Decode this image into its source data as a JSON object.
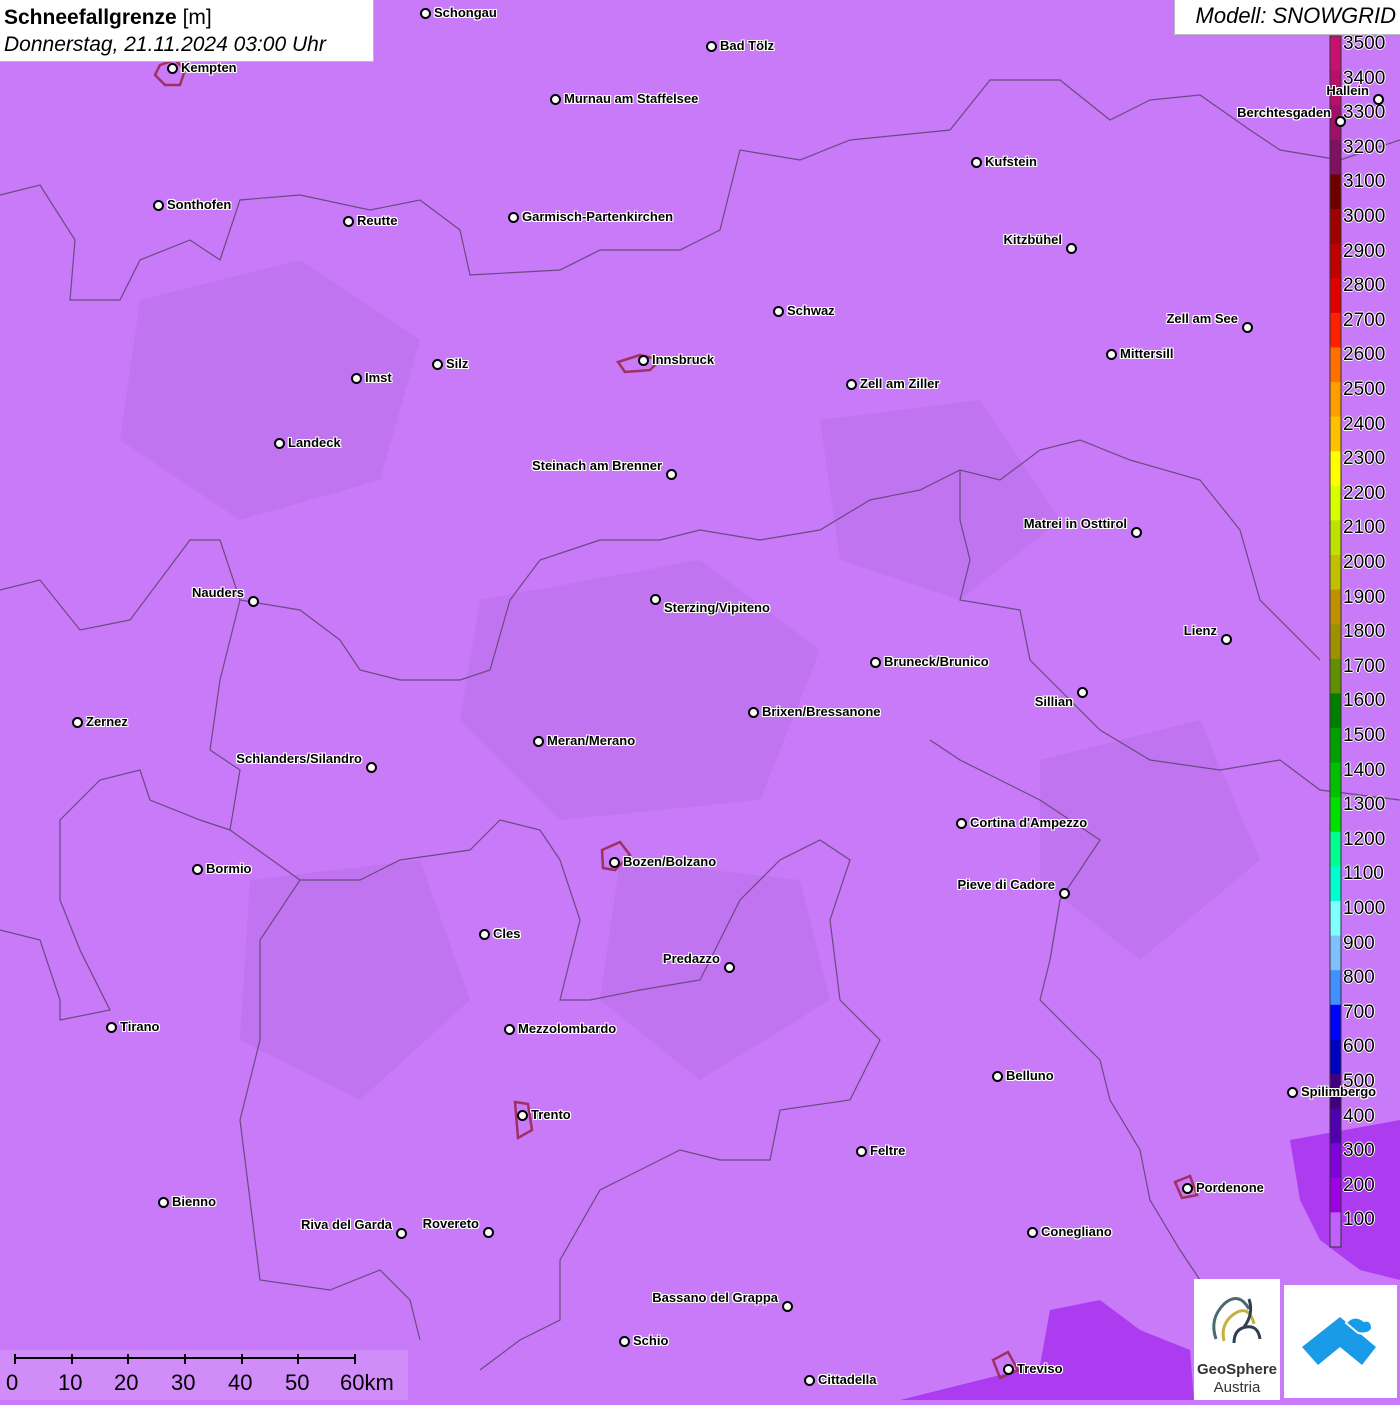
{
  "header": {
    "title_bold": "Schneefallgrenze",
    "title_unit": "[m]",
    "datetime": "Donnerstag, 21.11.2024 03:00 Uhr",
    "model": "Modell: SNOWGRID"
  },
  "legend": {
    "labels": [
      "3500",
      "3400",
      "3300",
      "3200",
      "3100",
      "3000",
      "2900",
      "2800",
      "2700",
      "2600",
      "2500",
      "2400",
      "2300",
      "2200",
      "2100",
      "2000",
      "1900",
      "1800",
      "1700",
      "1600",
      "1500",
      "1400",
      "1300",
      "1200",
      "1100",
      "1000",
      "900",
      "800",
      "700",
      "600",
      "500",
      "400",
      "300",
      "200",
      "100"
    ],
    "colors": [
      "#c8106e",
      "#b8106a",
      "#a01068",
      "#801060",
      "#700000",
      "#a00000",
      "#c00000",
      "#e00000",
      "#ff2000",
      "#ff7000",
      "#ff9c00",
      "#ffc000",
      "#ffff00",
      "#d8ff00",
      "#c0e000",
      "#c0c000",
      "#c09000",
      "#a09000",
      "#609000",
      "#008000",
      "#00a000",
      "#00c000",
      "#00e000",
      "#00ff90",
      "#00ffd0",
      "#80ffff",
      "#80c0ff",
      "#4090ff",
      "#0000ff",
      "#0000c0",
      "#400080",
      "#5000b0",
      "#8000e0",
      "#a000e8",
      "#c060ff"
    ]
  },
  "scale": {
    "labels": [
      "0",
      "10",
      "20",
      "30",
      "40",
      "50",
      "60km"
    ]
  },
  "logo": {
    "name": "GeoSphere",
    "sub": "Austria"
  },
  "cities": [
    {
      "name": "Schongau"
    },
    {
      "name": "Bad Tölz"
    },
    {
      "name": "Kempten"
    },
    {
      "name": "Murnau am Staffelsee"
    },
    {
      "name": "Hallein"
    },
    {
      "name": "Berchtesgaden"
    },
    {
      "name": "Kufstein"
    },
    {
      "name": "Sonthofen"
    },
    {
      "name": "Reutte"
    },
    {
      "name": "Garmisch-Partenkirchen"
    },
    {
      "name": "Kitzbühel"
    },
    {
      "name": "Schwaz"
    },
    {
      "name": "Zell am See"
    },
    {
      "name": "Mittersill"
    },
    {
      "name": "Innsbruck"
    },
    {
      "name": "Silz"
    },
    {
      "name": "Imst"
    },
    {
      "name": "Zell am Ziller"
    },
    {
      "name": "Landeck"
    },
    {
      "name": "Steinach am Brenner"
    },
    {
      "name": "Matrei in Osttirol"
    },
    {
      "name": "Nauders"
    },
    {
      "name": "Sterzing/Vipiteno"
    },
    {
      "name": "Lienz"
    },
    {
      "name": "Bruneck/Brunico"
    },
    {
      "name": "Sillian"
    },
    {
      "name": "Zernez"
    },
    {
      "name": "Brixen/Bressanone"
    },
    {
      "name": "Meran/Merano"
    },
    {
      "name": "Schlanders/Silandro"
    },
    {
      "name": "Cortina d'Ampezzo"
    },
    {
      "name": "Bozen/Bolzano"
    },
    {
      "name": "Bormio"
    },
    {
      "name": "Pieve di Cadore"
    },
    {
      "name": "Cles"
    },
    {
      "name": "Predazzo"
    },
    {
      "name": "Tirano"
    },
    {
      "name": "Mezzolombardo"
    },
    {
      "name": "Belluno"
    },
    {
      "name": "Spilimbergo"
    },
    {
      "name": "Trento"
    },
    {
      "name": "Feltre"
    },
    {
      "name": "Pordenone"
    },
    {
      "name": "Bienno"
    },
    {
      "name": "Riva del Garda"
    },
    {
      "name": "Rovereto"
    },
    {
      "name": "Conegliano"
    },
    {
      "name": "Bassano del Grappa"
    },
    {
      "name": "Schio"
    },
    {
      "name": "Treviso"
    },
    {
      "name": "Cittadella"
    }
  ]
}
